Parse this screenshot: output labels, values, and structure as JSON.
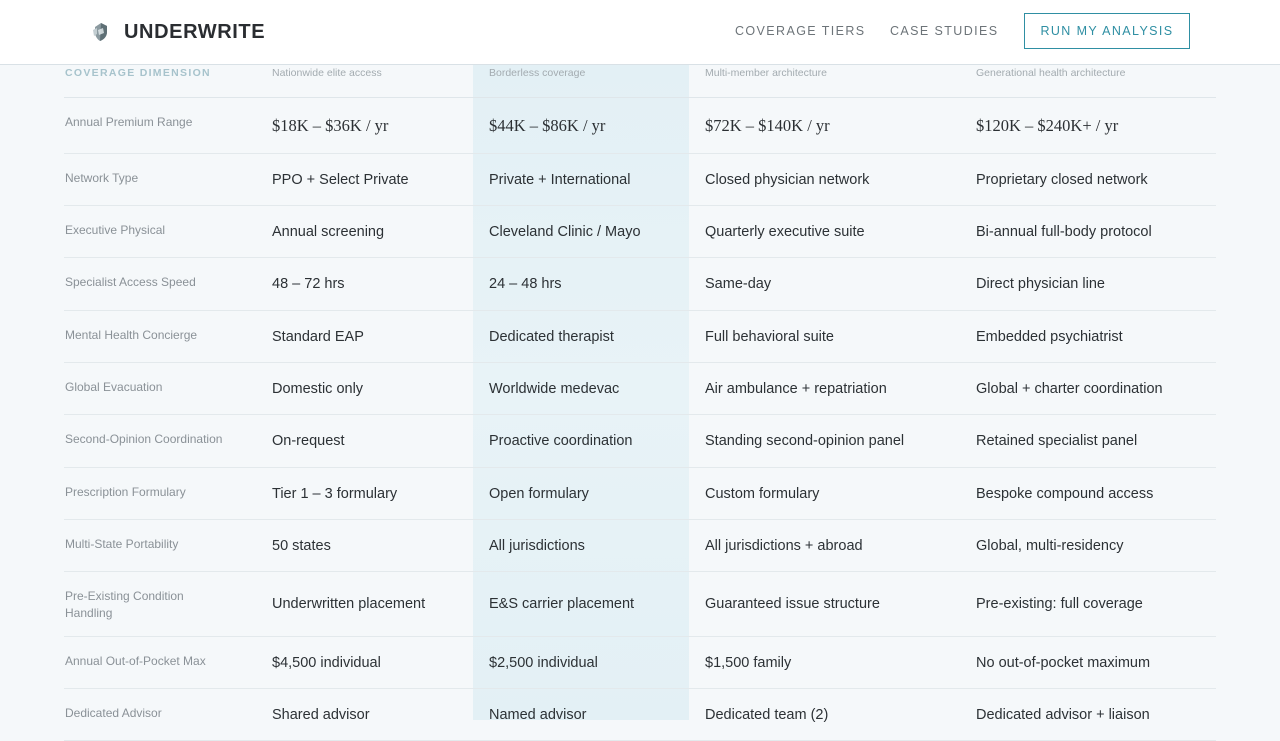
{
  "nav": {
    "brand": "UNDERWRITE",
    "links": [
      "COVERAGE TIERS",
      "CASE STUDIES"
    ],
    "cta": "RUN MY ANALYSIS"
  },
  "table": {
    "header": {
      "dimension": "COVERAGE DIMENSION",
      "tiers": [
        "Nationwide elite access",
        "Borderless coverage",
        "Multi-member architecture",
        "Generational health architecture"
      ]
    },
    "rows": [
      {
        "label": "Annual Premium Range",
        "values": [
          "$18K – $36K / yr",
          "$44K – $86K / yr",
          "$72K – $140K / yr",
          "$120K – $240K+ / yr"
        ]
      },
      {
        "label": "Network Type",
        "values": [
          "PPO + Select Private",
          "Private + International",
          "Closed physician network",
          "Proprietary closed network"
        ]
      },
      {
        "label": "Executive Physical",
        "values": [
          "Annual screening",
          "Cleveland Clinic / Mayo",
          "Quarterly executive suite",
          "Bi-annual full-body protocol"
        ]
      },
      {
        "label": "Specialist Access Speed",
        "values": [
          "48 – 72 hrs",
          "24 – 48 hrs",
          "Same-day",
          "Direct physician line"
        ]
      },
      {
        "label": "Mental Health Concierge",
        "values": [
          "Standard EAP",
          "Dedicated therapist",
          "Full behavioral suite",
          "Embedded psychiatrist"
        ]
      },
      {
        "label": "Global Evacuation",
        "values": [
          "Domestic only",
          "Worldwide medevac",
          "Air ambulance + repatriation",
          "Global + charter coordination"
        ]
      },
      {
        "label": "Second-Opinion Coordination",
        "values": [
          "On-request",
          "Proactive coordination",
          "Standing second-opinion panel",
          "Retained specialist panel"
        ]
      },
      {
        "label": "Prescription Formulary",
        "values": [
          "Tier 1 – 3 formulary",
          "Open formulary",
          "Custom formulary",
          "Bespoke compound access"
        ]
      },
      {
        "label": "Multi-State Portability",
        "values": [
          "50 states",
          "All jurisdictions",
          "All jurisdictions + abroad",
          "Global, multi-residency"
        ]
      },
      {
        "label": "Pre-Existing Condition Handling",
        "values": [
          "Underwritten placement",
          "E&S carrier placement",
          "Guaranteed issue structure",
          "Pre-existing: full coverage"
        ]
      },
      {
        "label": "Annual Out-of-Pocket Max",
        "values": [
          "$4,500 individual",
          "$2,500 individual",
          "$1,500 family",
          "No out-of-pocket maximum"
        ]
      },
      {
        "label": "Dedicated Advisor",
        "values": [
          "Shared advisor",
          "Named advisor",
          "Dedicated team (2)",
          "Dedicated advisor + liaison"
        ]
      }
    ]
  },
  "colors": {
    "accent": "#2f8fa3",
    "highlight_column": "#e3f0f5",
    "background": "#f5f8fa"
  }
}
